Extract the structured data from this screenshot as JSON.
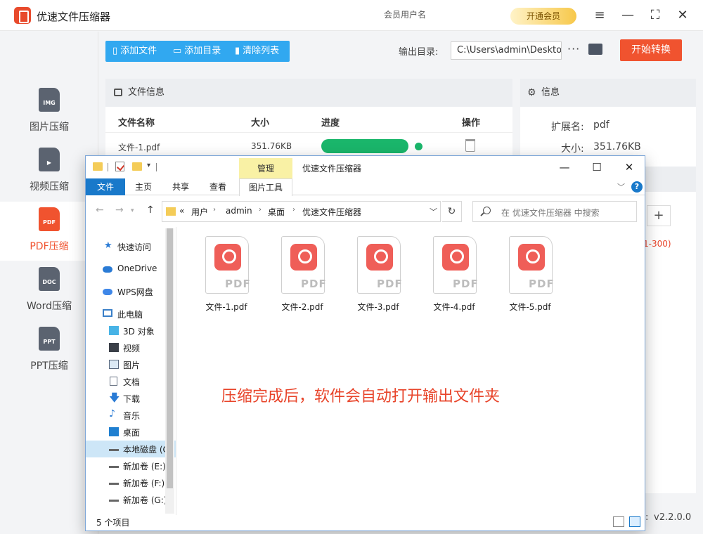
{
  "app": {
    "title": "优速文件压缩器",
    "user_text": "会员用户名",
    "vip_label": "开通会员",
    "version_label": "v2.2.0.0",
    "version_colon": ":"
  },
  "sidebar": {
    "items": [
      {
        "label": "图片压缩",
        "icon": "IMG"
      },
      {
        "label": "视频压缩",
        "icon": "▶"
      },
      {
        "label": "PDF压缩",
        "icon": "PDF"
      },
      {
        "label": "Word压缩",
        "icon": "DOC"
      },
      {
        "label": "PPT压缩",
        "icon": "PPT"
      }
    ],
    "active_index": 2
  },
  "toolbar": {
    "add_file": "添加文件",
    "add_dir": "添加目录",
    "clear_list": "清除列表",
    "output_label": "输出目录:",
    "output_path": "C:\\Users\\admin\\Desktop",
    "more": "···",
    "start": "开始转换"
  },
  "file_panel": {
    "title": "文件信息",
    "columns": {
      "name": "文件名称",
      "size": "大小",
      "progress": "进度",
      "action": "操作"
    },
    "rows": [
      {
        "name": "文件-1.pdf",
        "size": "351.76KB",
        "progress": 1.0
      }
    ]
  },
  "info_panel": {
    "title": "信息",
    "ext_label": "扩展名:",
    "ext_value": "pdf",
    "size_label": "大小:",
    "size_value": "351.76KB",
    "plus": "+",
    "range_text": "1-300)"
  },
  "explorer": {
    "title": "优速文件压缩器",
    "manage_tab": "管理",
    "ribbon_tabs": [
      "文件",
      "主页",
      "共享",
      "查看",
      "图片工具"
    ],
    "breadcrumb": [
      "«",
      "用户",
      "admin",
      "桌面",
      "优速文件压缩器"
    ],
    "search_placeholder": "在 优速文件压缩器 中搜索",
    "tree": [
      {
        "label": "快速访问",
        "icon": "star"
      },
      {
        "label": "OneDrive",
        "icon": "cloud"
      },
      {
        "label": "WPS网盘",
        "icon": "cloud"
      },
      {
        "label": "此电脑",
        "icon": "computer"
      },
      {
        "label": "3D 对象",
        "icon": "cube"
      },
      {
        "label": "视频",
        "icon": "film"
      },
      {
        "label": "图片",
        "icon": "picture"
      },
      {
        "label": "文档",
        "icon": "doc"
      },
      {
        "label": "下载",
        "icon": "download"
      },
      {
        "label": "音乐",
        "icon": "music"
      },
      {
        "label": "桌面",
        "icon": "desktop"
      },
      {
        "label": "本地磁盘 (C:)",
        "icon": "drive"
      },
      {
        "label": "新加卷 (E:)",
        "icon": "drive"
      },
      {
        "label": "新加卷 (F:)",
        "icon": "drive"
      },
      {
        "label": "新加卷 (G:)",
        "icon": "drive"
      }
    ],
    "files": [
      {
        "name": "文件-1.pdf"
      },
      {
        "name": "文件-2.pdf"
      },
      {
        "name": "文件-3.pdf"
      },
      {
        "name": "文件-4.pdf"
      },
      {
        "name": "文件-5.pdf"
      }
    ],
    "pdf_badge_text": "PDF",
    "status": "5 个项目",
    "annotation": "压缩完成后，软件会自动打开输出文件夹"
  },
  "colors": {
    "accent_blue": "#31a8f0",
    "accent_orange": "#f0532f",
    "progress_green": "#1ab66b",
    "annotation_red": "#e8442a"
  }
}
